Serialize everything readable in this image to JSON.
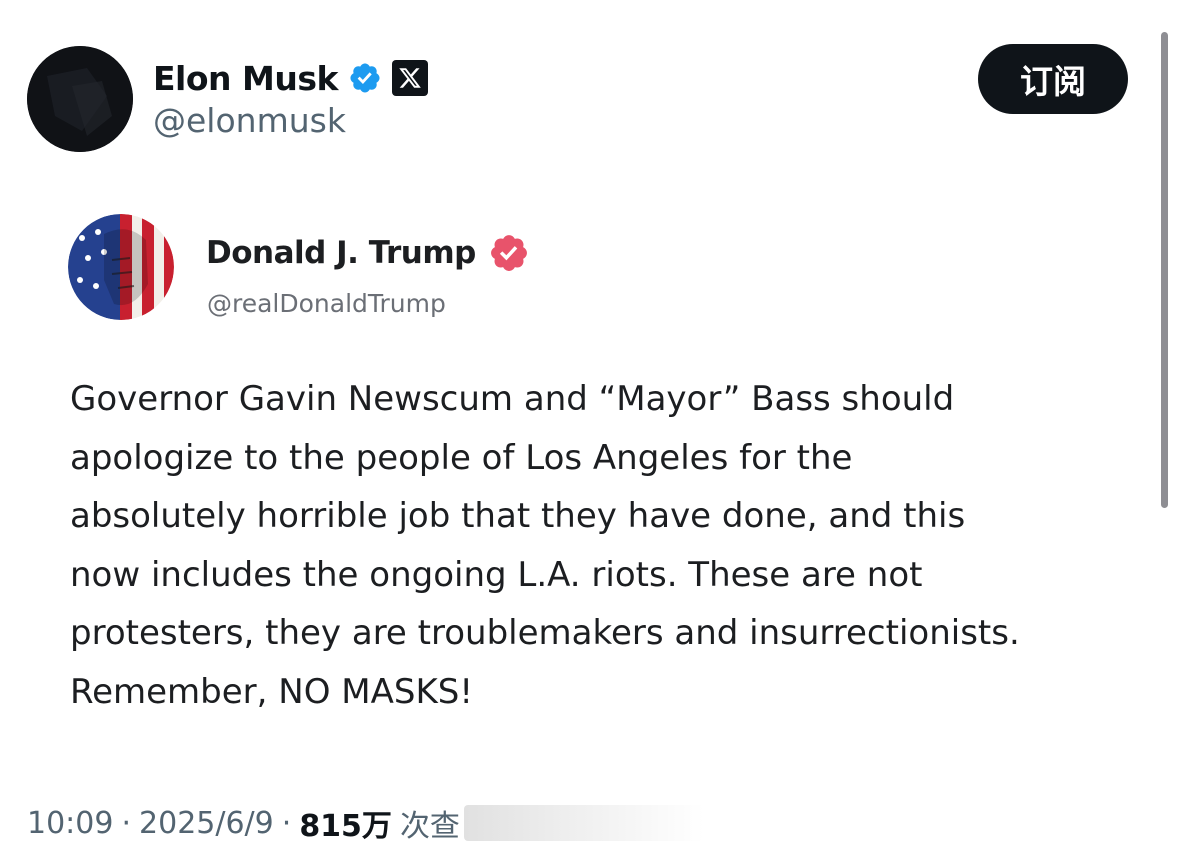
{
  "tweet": {
    "author_name": "Elon Musk",
    "author_handle": "@elonmusk",
    "subscribe_label": "订阅",
    "verified_color": "#1d9bf0",
    "icons": [
      "avatar",
      "verified-badge-icon",
      "x-logo-icon"
    ]
  },
  "embedded_post": {
    "author_name": "Donald J. Trump",
    "author_handle": "@realDonaldTrump",
    "verified_color": "#e8536b",
    "body_lines": [
      "Governor Gavin Newscum and “Mayor” Bass should",
      "apologize to the people of Los Angeles for the",
      "absolutely horrible job that they have done, and this",
      "now includes the ongoing L.A. riots. These are not",
      "protesters, they are troublemakers and insurrectionists.",
      "Remember, NO MASKS!"
    ]
  },
  "meta": {
    "time": "10:09",
    "date": "2025/6/9",
    "views_count": "815万",
    "views_label": "次查",
    "separator": "·"
  }
}
